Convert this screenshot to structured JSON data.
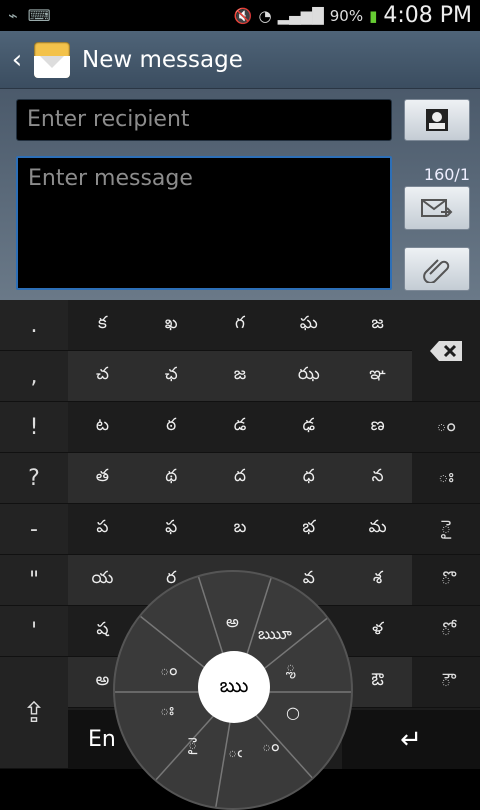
{
  "status": {
    "battery": "90%",
    "time": "4:08 PM"
  },
  "header": {
    "title": "New message"
  },
  "compose": {
    "recipient_placeholder": "Enter recipient",
    "message_placeholder": "Enter message",
    "counter": "160/1"
  },
  "keyboard": {
    "left_keys": [
      ".",
      ",",
      "!",
      "?",
      "-",
      "\"",
      "'"
    ],
    "rows": [
      [
        "క",
        "ఖ",
        "గ",
        "ఘ",
        "జ"
      ],
      [
        "చ",
        "ఛ",
        "జ",
        "ఝ",
        "ఞ"
      ],
      [
        "ట",
        "ఠ",
        "డ",
        "ఢ",
        "ణ"
      ],
      [
        "త",
        "థ",
        "ద",
        "ధ",
        "న"
      ],
      [
        "ప",
        "ఫ",
        "బ",
        "భ",
        "మ"
      ],
      [
        "య",
        "ర",
        "",
        "వ",
        "శ"
      ],
      [
        "ష",
        "",
        "",
        "",
        "ళ"
      ],
      [
        "అ",
        "",
        "",
        "",
        "ఔ"
      ]
    ],
    "right_keys": [
      "",
      "ం",
      "ః",
      "ై",
      "ొ",
      "ో",
      "ౌ"
    ],
    "lang_label": "En",
    "wheel": {
      "center": "ఋ",
      "top": "అ",
      "upper_right": "ఋూ",
      "right": "ౢ",
      "left": "ం",
      "lower_left": "ః",
      "bottom_left": "ై",
      "bottom": "ఁ",
      "bottom_right": "ం"
    }
  },
  "colors": {
    "accent": "#2d6fb7"
  }
}
